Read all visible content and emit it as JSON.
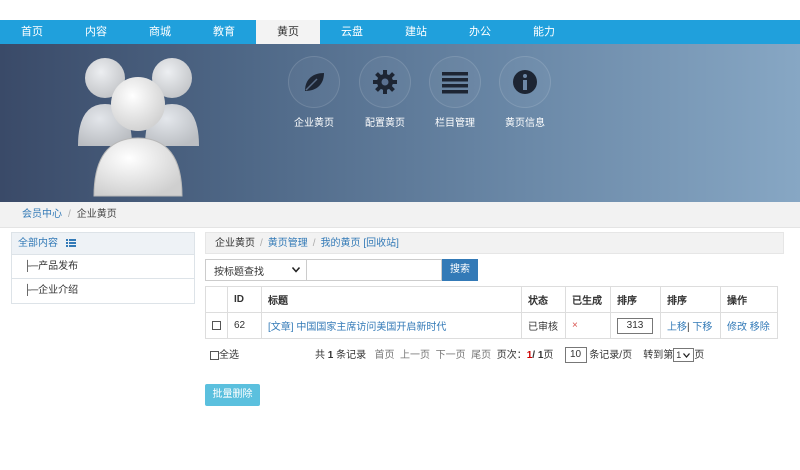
{
  "nav": {
    "items": [
      "首页",
      "内容",
      "商城",
      "教育",
      "黄页",
      "云盘",
      "建站",
      "办公",
      "能力"
    ],
    "active_index": 4
  },
  "banner": {
    "tools": [
      {
        "label": "企业黄页",
        "icon": "leaf-icon"
      },
      {
        "label": "配置黄页",
        "icon": "gear-icon"
      },
      {
        "label": "栏目管理",
        "icon": "list-icon"
      },
      {
        "label": "黄页信息",
        "icon": "info-icon"
      }
    ]
  },
  "breadcrumb": {
    "home": "会员中心",
    "sep": "/",
    "current": "企业黄页"
  },
  "sidebar": {
    "title": "全部内容",
    "title_icon": "list-icon",
    "items": [
      "├─产品发布",
      "├─企业介绍"
    ]
  },
  "subcrumb": {
    "items": [
      "企业黄页",
      "黄页管理",
      "我的黄页"
    ],
    "sep": "/",
    "recycle": "[回收站]"
  },
  "search": {
    "select_value": "按标题查找",
    "button": "搜索"
  },
  "table": {
    "headers": [
      "",
      "ID",
      "标题",
      "状态",
      "已生成",
      "排序",
      "排序",
      "操作"
    ],
    "rows": [
      {
        "id": "62",
        "title": "[文章] 中国国家主席访问美国开启新时代",
        "status": "已审核",
        "generated": "×",
        "sort": "313",
        "move_up": "上移",
        "move_sep": "|",
        "move_down": "下移",
        "edit": "修改",
        "remove": "移除"
      }
    ]
  },
  "pager": {
    "select_all": "全选",
    "total_prefix": "共",
    "total": "1",
    "total_suffix": "条记录",
    "first": "首页",
    "prev": "上一页",
    "next": "下一页",
    "last": "尾页",
    "page_label": "页次：",
    "current_page": "1",
    "page_sep": "/",
    "page_total": "1",
    "page_word": "页",
    "per_page": "10",
    "per_page_suffix": "条记录/页",
    "goto_prefix": "转到第",
    "goto_value": "1",
    "goto_suffix": "页"
  },
  "batch_delete": "批量删除"
}
